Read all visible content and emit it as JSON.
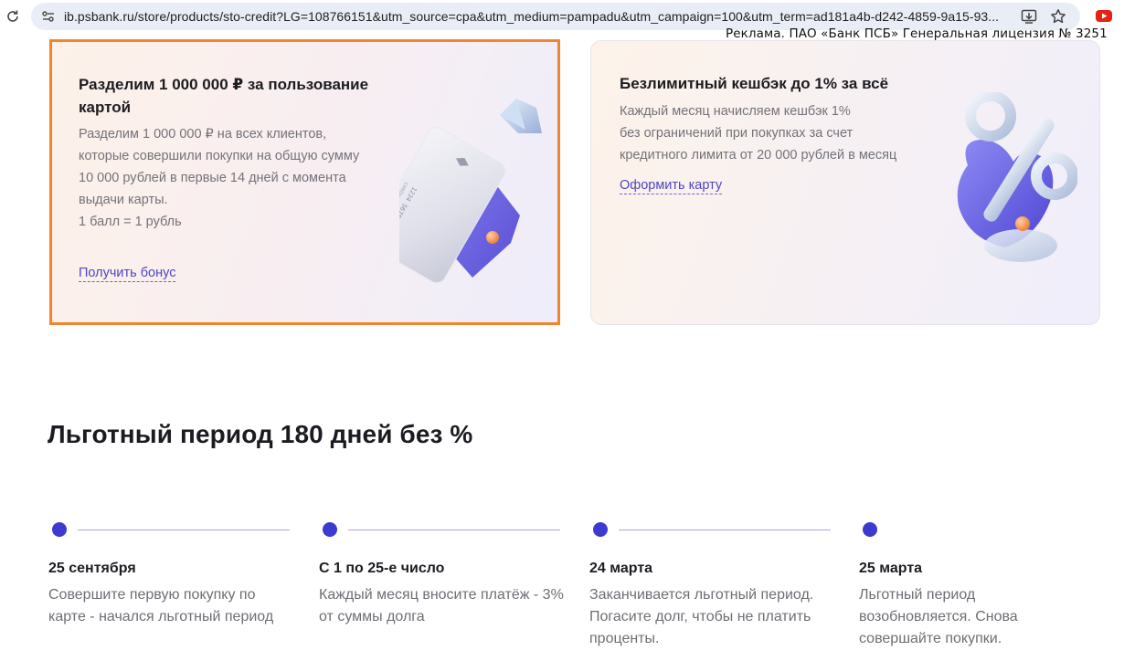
{
  "browser": {
    "url": "ib.psbank.ru/store/products/sto-credit?LG=108766151&utm_source=cpa&utm_medium=pampadu&utm_campaign=100&utm_term=ad181a4b-d242-4859-9a15-93...",
    "icons": [
      "reload-icon",
      "site-info-icon",
      "install-icon",
      "star-icon",
      "youtube-icon"
    ]
  },
  "ad_label": "Реклама.  ПАО «Банк ПСБ» Генеральная лицензия  № 3251",
  "cards": {
    "bonus": {
      "title": "Разделим 1 000 000 ₽ за пользование картой",
      "desc": [
        "Разделим 1 000 000 ₽ на всех клиентов,",
        "которые совершили покупки на общую сумму",
        "10 000 рублей в первые 14 дней с момента",
        "выдачи карты.",
        "1 балл = 1 рубль"
      ],
      "link": "Получить бонус",
      "card_number": "1234  5678  9000  0000",
      "card_holder": "CARDHOLDER NAME",
      "highlight_color": "#f2852b"
    },
    "cashback": {
      "title": "Безлимитный кешбэк до 1% за всё",
      "desc": [
        "Каждый месяц начисляем кешбэк 1%",
        "без ограничений при покупках за счет",
        "кредитного лимита от 20 000 рублей в месяц"
      ],
      "link": "Оформить карту"
    }
  },
  "section": {
    "title": "Льготный период 180 дней без %",
    "steps": [
      {
        "title": "25 сентября",
        "desc": "Совершите первую покупку по карте - начался льготный период"
      },
      {
        "title": "С 1 по 25-е число",
        "desc": "Каждый месяц вносите платёж - 3% от суммы долга"
      },
      {
        "title": "24 марта",
        "desc": "Заканчивается льготный период. Погасите долг, чтобы не платить проценты."
      },
      {
        "title": "25 марта",
        "desc": "Льготный период возобновляется. Снова совершайте покупки."
      }
    ]
  },
  "colors": {
    "accent": "#3b3bd1",
    "link": "#4f46c5",
    "highlight": "#f2852b"
  }
}
